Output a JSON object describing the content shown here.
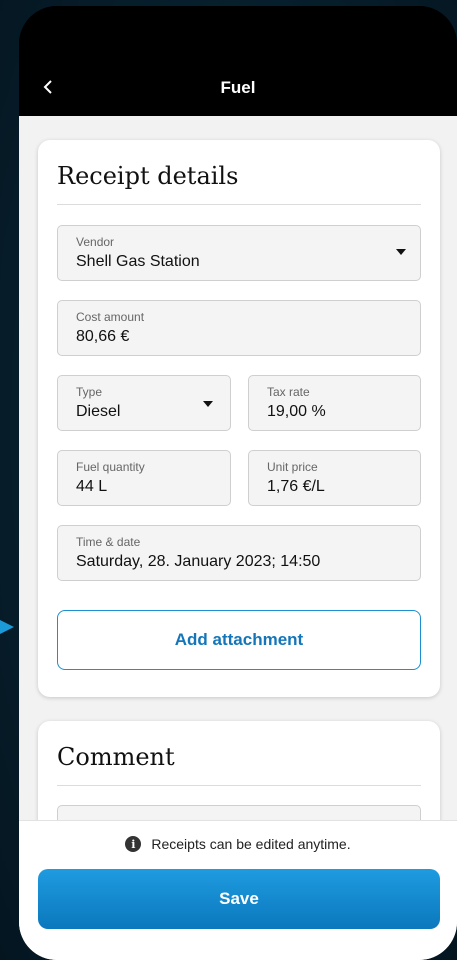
{
  "header": {
    "title": "Fuel",
    "back_icon": "chevron-left-icon"
  },
  "receipt": {
    "title": "Receipt details",
    "vendor": {
      "label": "Vendor",
      "value": "Shell Gas Station"
    },
    "cost": {
      "label": "Cost amount",
      "value": "80,66 €"
    },
    "type": {
      "label": "Type",
      "value": "Diesel"
    },
    "tax": {
      "label": "Tax rate",
      "value": "19,00 %"
    },
    "fuel_qty": {
      "label": "Fuel quantity",
      "value": "44 L"
    },
    "unit_price": {
      "label": "Unit price",
      "value": "1,76 €/L"
    },
    "datetime": {
      "label": "Time & date",
      "value": "Saturday, 28. January 2023; 14:50"
    },
    "attach_label": "Add attachment"
  },
  "comment": {
    "title": "Comment"
  },
  "footer": {
    "hint": "Receipts can be edited anytime.",
    "save_label": "Save"
  },
  "colors": {
    "accent": "#1476b8",
    "save": "#0b78bd",
    "background": "#07202d"
  }
}
